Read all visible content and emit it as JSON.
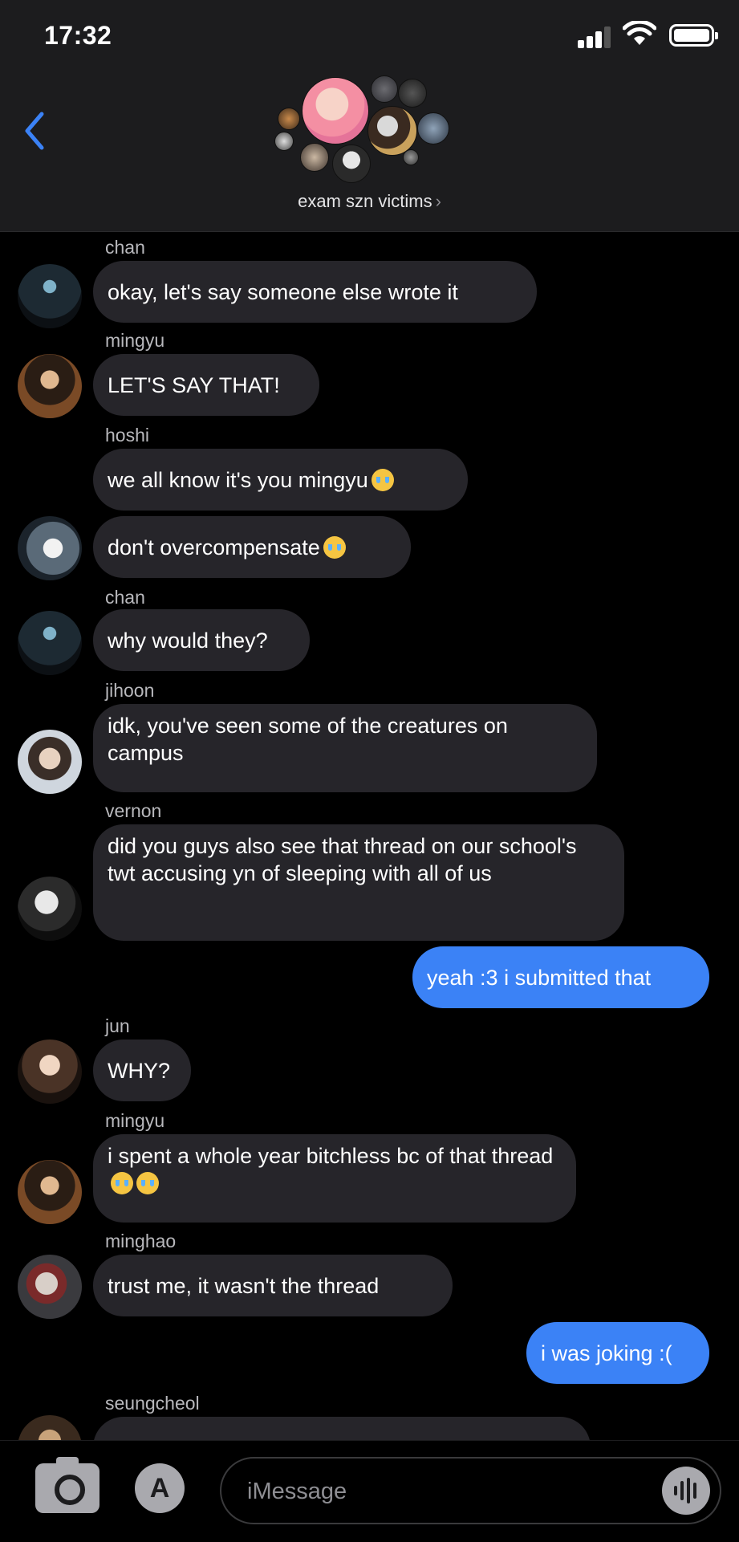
{
  "status_bar": {
    "time": "17:32"
  },
  "header": {
    "group_name": "exam szn victims",
    "chevron": "›"
  },
  "input": {
    "placeholder": "iMessage"
  },
  "messages": [
    {
      "sender": "chan",
      "text": "okay, let's say someone else wrote it"
    },
    {
      "sender": "mingyu",
      "text": "LET'S SAY THAT!"
    },
    {
      "sender": "hoshi",
      "text": "we all know it's you mingyu"
    },
    {
      "text": "don't overcompensate"
    },
    {
      "sender": "chan",
      "text": "why would they?"
    },
    {
      "sender": "jihoon",
      "text": "idk, you've seen some of the creatures on campus"
    },
    {
      "sender": "vernon",
      "text": "did you guys also see that thread on our school's twt accusing yn of sleeping with all of us"
    },
    {
      "text": "yeah :3 i submitted that",
      "outgoing": true
    },
    {
      "sender": "jun",
      "text": "WHY?"
    },
    {
      "sender": "mingyu",
      "text": "i spent a whole year bitchless bc of that thread"
    },
    {
      "sender": "minghao",
      "text": "trust me, it wasn't the thread"
    },
    {
      "text": "i was joking :(",
      "outgoing": true
    },
    {
      "sender": "seungcheol"
    }
  ],
  "emoji_names": [
    "loudly-crying-face"
  ],
  "colors": {
    "background": "#000000",
    "incoming_bubble": "#26252a",
    "outgoing_bubble": "#3b82f6",
    "header_bg": "#1c1c1e",
    "back_chevron": "#3b82f6"
  }
}
